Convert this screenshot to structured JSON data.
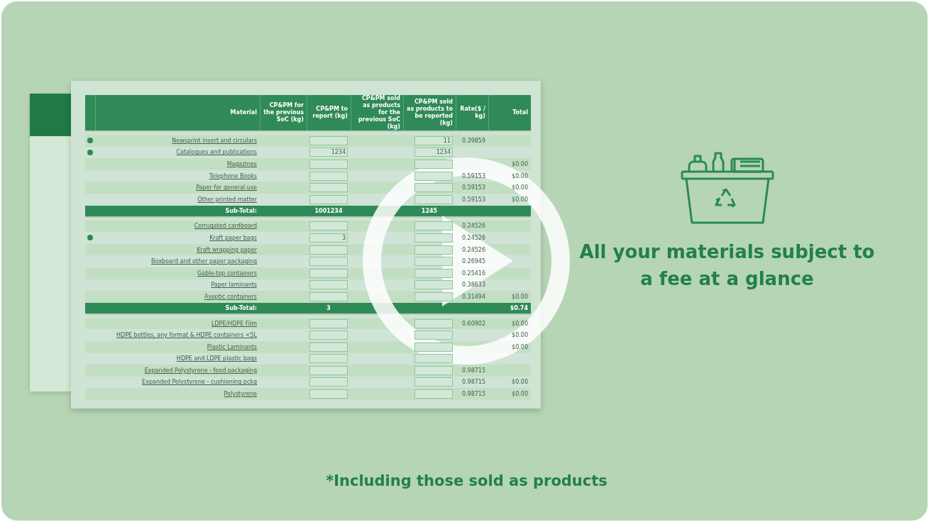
{
  "table": {
    "columns": [
      "Material",
      "CP&PM for the previous SoC (kg)",
      "CP&PM to report (kg)",
      "CP&PM sold as products for the previous SoC (kg)",
      "CP&PM sold as products to be reported (kg)",
      "Rate($ / kg)",
      "Total"
    ],
    "sections": [
      {
        "rows": [
          {
            "material": "Newsprint insert and circulars",
            "marked": true,
            "sold_reported": "11",
            "rate": "0.39859"
          },
          {
            "material": "Catalogues and publications",
            "marked": true,
            "reported": "1234",
            "sold_reported": "1234"
          },
          {
            "material": "Magazines",
            "marked": false,
            "total": "$0.00"
          },
          {
            "material": "Telephone Books",
            "marked": false,
            "rate": "0.59153",
            "total": "$0.00"
          },
          {
            "material": "Paper for general use",
            "marked": false,
            "rate": "0.59153",
            "total": "$0.00"
          },
          {
            "material": "Other printed matter",
            "marked": false,
            "rate": "0.59153",
            "total": "$0.00"
          }
        ],
        "subtotal": {
          "label": "Sub-Total:",
          "reported": "1001234",
          "sold_reported": "1245"
        }
      },
      {
        "rows": [
          {
            "material": "Corrugated cardboard",
            "marked": false,
            "rate": "0.24526"
          },
          {
            "material": "Kraft paper bags",
            "marked": true,
            "reported": "3",
            "rate": "0.24526"
          },
          {
            "material": "Kraft wrapping paper",
            "marked": false,
            "rate": "0.24526"
          },
          {
            "material": "Boxboard and other paper packaging",
            "marked": false,
            "rate": "0.26945"
          },
          {
            "material": "Gable-top containers",
            "marked": false,
            "rate": "0.25416"
          },
          {
            "material": "Paper laminants",
            "marked": false,
            "rate": "0.38633"
          },
          {
            "material": "Aseptic containers",
            "marked": false,
            "rate": "0.31494",
            "total": "$0.00"
          }
        ],
        "subtotal": {
          "label": "Sub-Total:",
          "reported": "3",
          "total": "$0.74"
        }
      },
      {
        "rows": [
          {
            "material": "LDPE/HDPE Film",
            "marked": false,
            "rate": "0.60902",
            "total": "$0.00"
          },
          {
            "material": "HDPE bottles, any format & HDPE containers <5L",
            "marked": false,
            "total": "$0.00"
          },
          {
            "material": "Plastic Laminants",
            "marked": false,
            "total": "$0.00"
          },
          {
            "material": "HDPE and LDPE plastic bags",
            "marked": false
          },
          {
            "material": "Expanded Polystyrene - food packaging",
            "marked": false,
            "rate": "0.98715"
          },
          {
            "material": "Expanded Polystyrene - cushioning pckg",
            "marked": false,
            "rate": "0.98715",
            "total": "$0.00"
          },
          {
            "material": "Polystyrene",
            "marked": false,
            "rate": "0.98715",
            "total": "$0.00"
          }
        ]
      }
    ]
  },
  "promo": {
    "heading": "All your materials subject to a fee at a glance",
    "footnote": "*Including those sold as products"
  }
}
